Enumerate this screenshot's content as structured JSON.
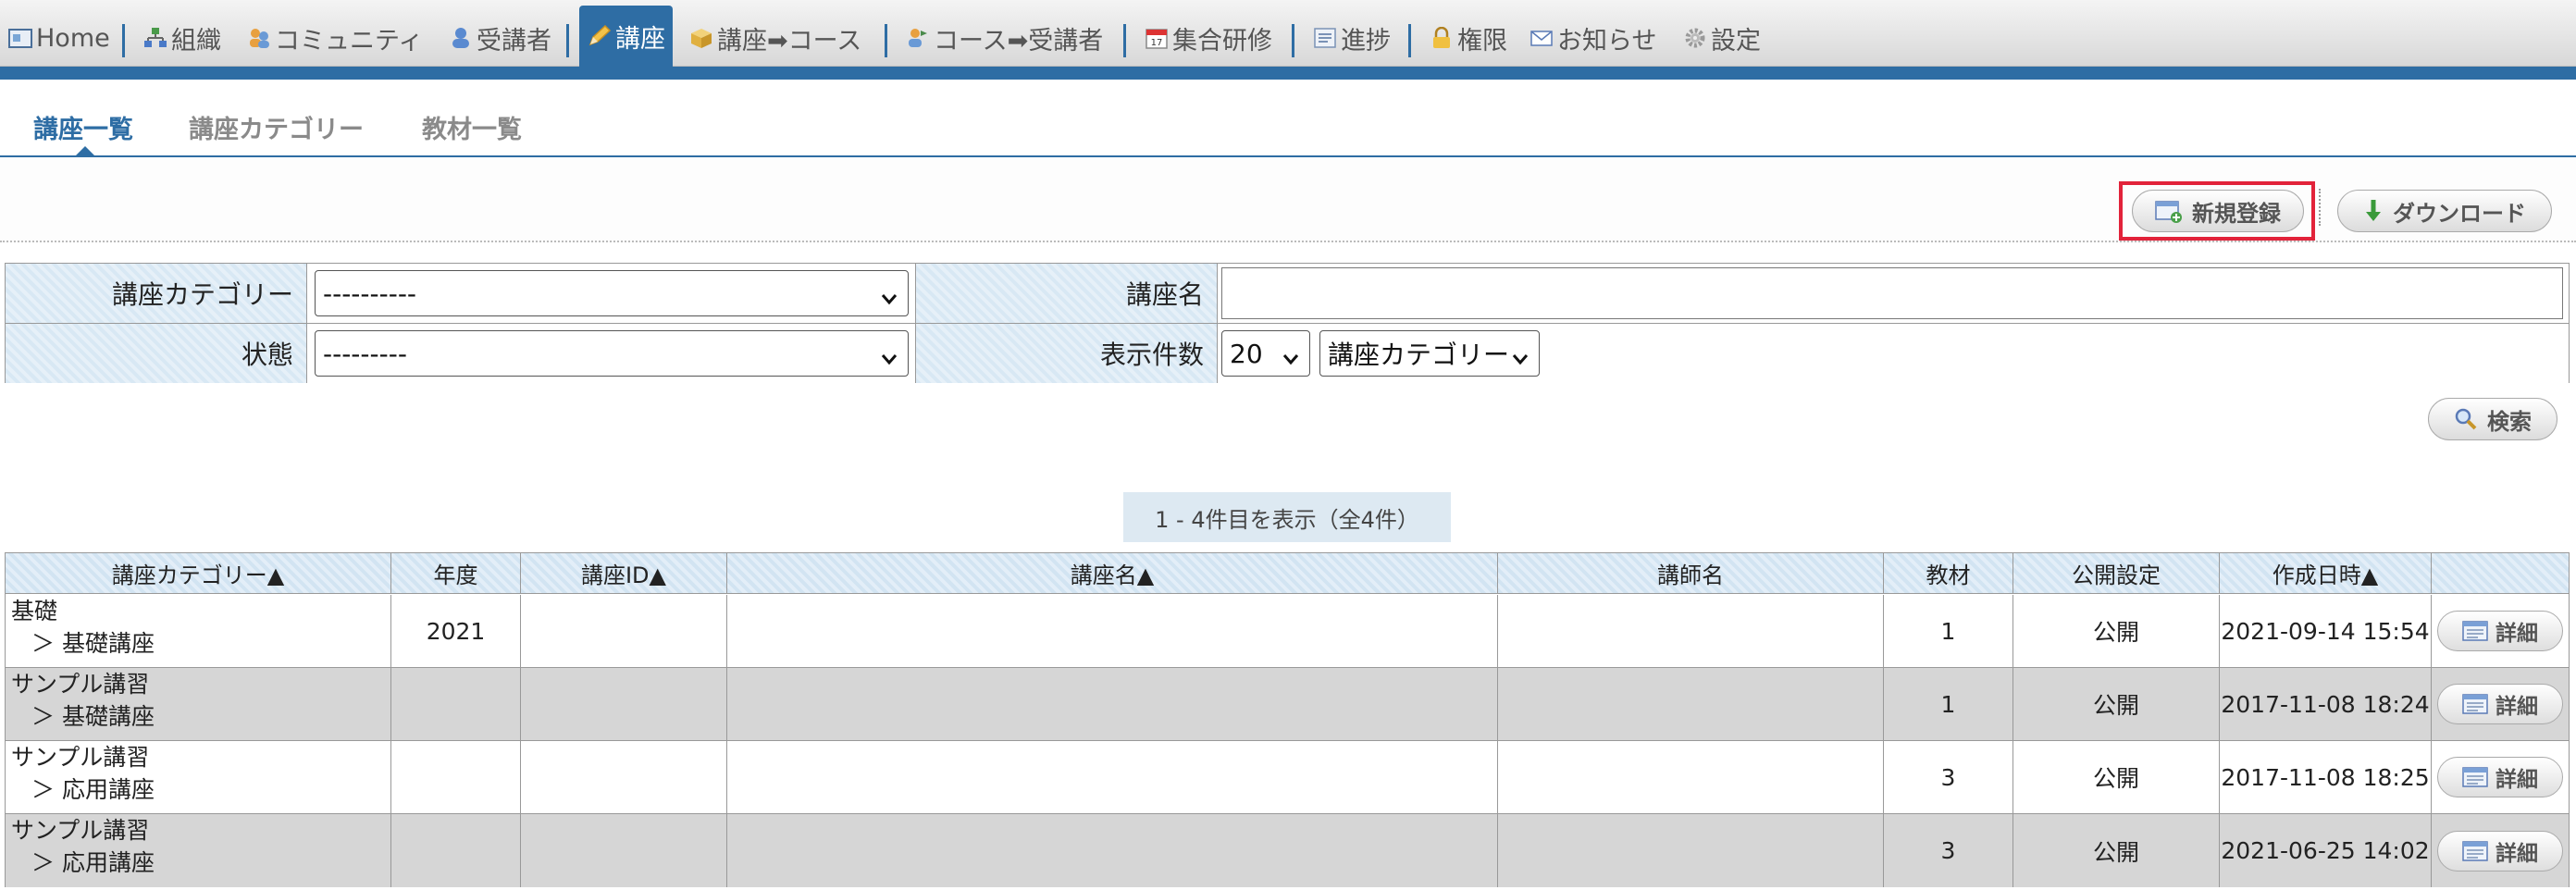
{
  "nav": {
    "items": [
      {
        "label": "Home",
        "icon": "home-icon"
      },
      {
        "label": "組織",
        "icon": "organization-icon"
      },
      {
        "label": "コミュニティ",
        "icon": "community-icon"
      },
      {
        "label": "受講者",
        "icon": "student-icon"
      },
      {
        "label": "講座",
        "icon": "pencil-icon"
      },
      {
        "label": "講座➡コース",
        "icon": "box-icon"
      },
      {
        "label": "コース➡受講者",
        "icon": "course-user-icon"
      },
      {
        "label": "集合研修",
        "icon": "calendar-icon"
      },
      {
        "label": "進捗",
        "icon": "progress-icon"
      },
      {
        "label": "権限",
        "icon": "lock-icon"
      },
      {
        "label": "お知らせ",
        "icon": "mail-icon"
      },
      {
        "label": "設定",
        "icon": "gear-icon"
      }
    ],
    "active": "講座"
  },
  "subtabs": [
    "講座一覧",
    "講座カテゴリー",
    "教材一覧"
  ],
  "toolbar": {
    "new_label": "新規登録",
    "download_label": "ダウンロード"
  },
  "search": {
    "category_label": "講座カテゴリー",
    "category_value": "----------",
    "name_label": "講座名",
    "name_value": "",
    "status_label": "状態",
    "status_value": "---------",
    "count_label": "表示件数",
    "count_value": "20",
    "sort_value": "講座カテゴリー",
    "search_button": "検索"
  },
  "paging": {
    "text": "1 - 4件目を表示（全4件）"
  },
  "table": {
    "headers": [
      "講座カテゴリー▲",
      "年度",
      "講座ID▲",
      "講座名▲",
      "講師名",
      "教材",
      "公開設定",
      "作成日時▲",
      ""
    ],
    "rows": [
      {
        "cat1": "基礎",
        "cat2": "＞ 基礎講座",
        "year": "2021",
        "id": "",
        "name": "",
        "teacher": "",
        "material": "1",
        "public": "公開",
        "created": "2021-09-14 15:54",
        "detail": "詳細"
      },
      {
        "cat1": "サンプル講習",
        "cat2": "＞ 基礎講座",
        "year": "",
        "id": "",
        "name": "",
        "teacher": "",
        "material": "1",
        "public": "公開",
        "created": "2017-11-08 18:24",
        "detail": "詳細"
      },
      {
        "cat1": "サンプル講習",
        "cat2": "＞ 応用講座",
        "year": "",
        "id": "",
        "name": "",
        "teacher": "",
        "material": "3",
        "public": "公開",
        "created": "2017-11-08 18:25",
        "detail": "詳細"
      },
      {
        "cat1": "サンプル講習",
        "cat2": "＞ 応用講座",
        "year": "",
        "id": "",
        "name": "",
        "teacher": "",
        "material": "3",
        "public": "公開",
        "created": "2021-06-25 14:02",
        "detail": "詳細"
      }
    ]
  },
  "colors": {
    "accent": "#2e6da4",
    "highlight": "#e2233a",
    "row_alt": "#d6d6d6"
  }
}
